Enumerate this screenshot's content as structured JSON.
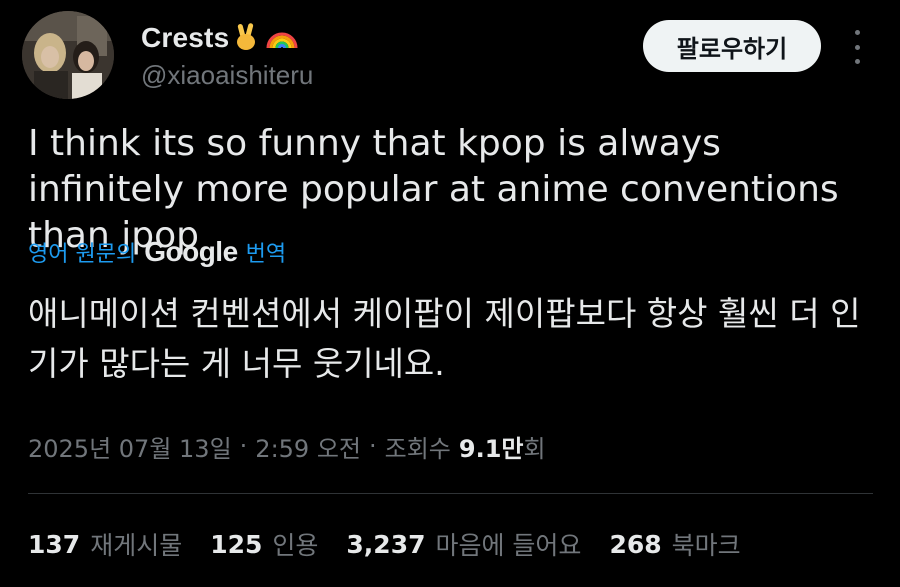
{
  "user": {
    "display_name": "Crests",
    "handle": "@xiaoaishiteru",
    "emojis": [
      "victory-hand-emoji",
      "rainbow-emoji"
    ]
  },
  "actions": {
    "follow_label": "팔로우하기",
    "more_icon": "more-dots-icon"
  },
  "tweet": {
    "text": "I think its so funny that kpop is always infinitely more popular at anime conventions than jpop"
  },
  "translation": {
    "prefix": "영어 원문의",
    "brand": "Google",
    "suffix": "번역",
    "text": "애니메이션 컨벤션에서 케이팝이 제이팝보다 항상 훨씬 더 인기가 많다는 게 너무 웃기네요."
  },
  "meta": {
    "date": "2025년 07월 13일",
    "time": "2:59 오전",
    "views_label": "조회수",
    "views_count": "9.1만",
    "views_suffix": "회"
  },
  "stats": [
    {
      "count": "137",
      "label": "재게시물"
    },
    {
      "count": "125",
      "label": "인용"
    },
    {
      "count": "3,237",
      "label": "마음에 들어요"
    },
    {
      "count": "268",
      "label": "북마크"
    }
  ],
  "colors": {
    "background": "#000000",
    "text_primary": "#e7e9ea",
    "text_secondary": "#71767b",
    "link": "#1d9bf0",
    "divider": "#2f3336",
    "follow_button_bg": "#eff3f4"
  }
}
